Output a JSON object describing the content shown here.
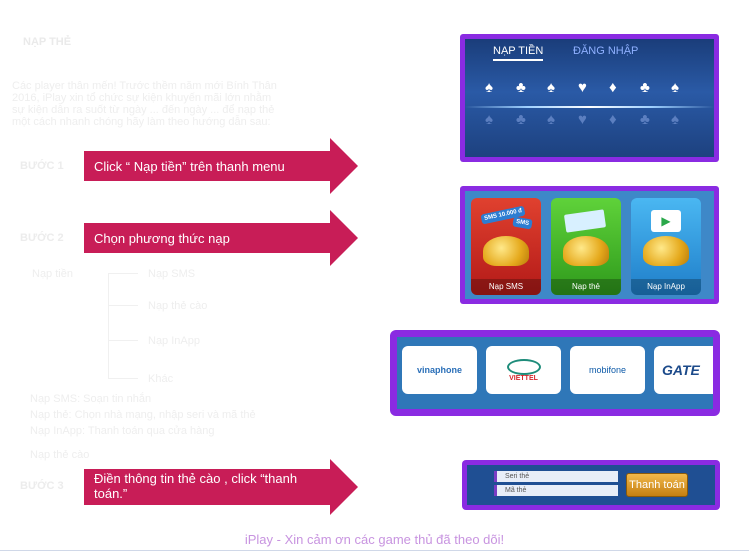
{
  "article": {
    "heading": "NẠP THẺ",
    "intro_lines": [
      "Các player thân mến! Trước thềm năm mới Bính Thân",
      "2016, iPlay xin tổ chức sự kiện khuyến mãi lớn nhằm",
      "sự kiện dẫn ra suốt từ ngày ... đến ngày ... để nạp thẻ",
      "một cách nhanh chóng hãy làm theo hướng dẫn sau:"
    ],
    "step1": "BƯỚC 1",
    "step2": "BƯỚC 2",
    "step3": "BƯỚC 3",
    "tree_root": "Nạp tiền",
    "tree_items": [
      "Nạp SMS",
      "Nạp thẻ cào",
      "Nạp InApp",
      "Khác"
    ],
    "notes": [
      "Nạp SMS: Soạn tin nhắn",
      "Nạp thẻ: Chọn nhà mạng, nhập seri và mã thẻ",
      "Nạp InApp: Thanh toán qua cửa hàng",
      "Nạp thẻ cào"
    ]
  },
  "steps": {
    "step1_label": "Click “ Nạp tiền” trên thanh menu",
    "step2_label": "Chọn phương thức nạp",
    "step3_label": "Điền thông tin thẻ cào , click “thanh toán.”"
  },
  "menu_panel": {
    "tab_active": "NẠP TIỀN",
    "tab_login": "ĐĂNG NHẬP"
  },
  "payment_panel": {
    "methods": [
      "Nạp SMS",
      "Nạp thẻ",
      "Nạp InApp"
    ],
    "sms_tags": [
      "SMS 10.000 đ",
      "SMS"
    ]
  },
  "carrier_panel": {
    "carriers": [
      "vinaphone",
      "VIETTEL",
      "mobifone",
      "GATE"
    ]
  },
  "card_form": {
    "serial_placeholder": "Seri thẻ",
    "code_placeholder": "Mã thẻ",
    "submit_label": "Thanh toán"
  },
  "footer": {
    "message": "iPlay - Xin cảm ơn các game thủ đã theo dõi!"
  },
  "colors": {
    "banner": "#c81d57",
    "frame": "#8a2be2",
    "footer_text": "#c894e0",
    "tab_active_underline": "#ffffff",
    "tab_login": "#8fb0ff"
  }
}
